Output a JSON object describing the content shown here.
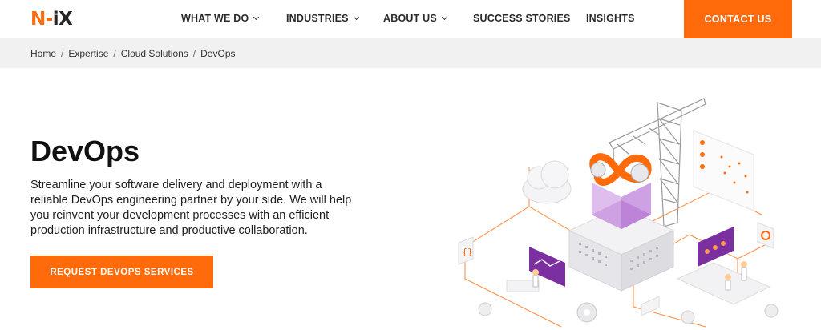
{
  "header": {
    "logo": {
      "n": "N",
      "dash": "-",
      "ix": "iX"
    },
    "nav": [
      {
        "label": "WHAT WE DO",
        "has_dropdown": true
      },
      {
        "label": "INDUSTRIES",
        "has_dropdown": true
      },
      {
        "label": "ABOUT US",
        "has_dropdown": true
      },
      {
        "label": "SUCCESS STORIES",
        "has_dropdown": false
      },
      {
        "label": "INSIGHTS",
        "has_dropdown": false
      }
    ],
    "contact_label": "CONTACT US"
  },
  "breadcrumb": {
    "items": [
      "Home",
      "Expertise",
      "Cloud Solutions",
      "DevOps"
    ],
    "separator": "/"
  },
  "hero": {
    "title": "DevOps",
    "description": "Streamline your software delivery and deployment with a reliable DevOps engineering partner by your side. We will help you reinvent your development processes with an efficient production infrastructure and productive collaboration.",
    "cta_label": "REQUEST DEVOPS SERVICES"
  },
  "colors": {
    "accent": "#ff6b0b",
    "breadcrumb_bg": "#f1f1f1",
    "illustration_purple": "#7b2fa0"
  }
}
